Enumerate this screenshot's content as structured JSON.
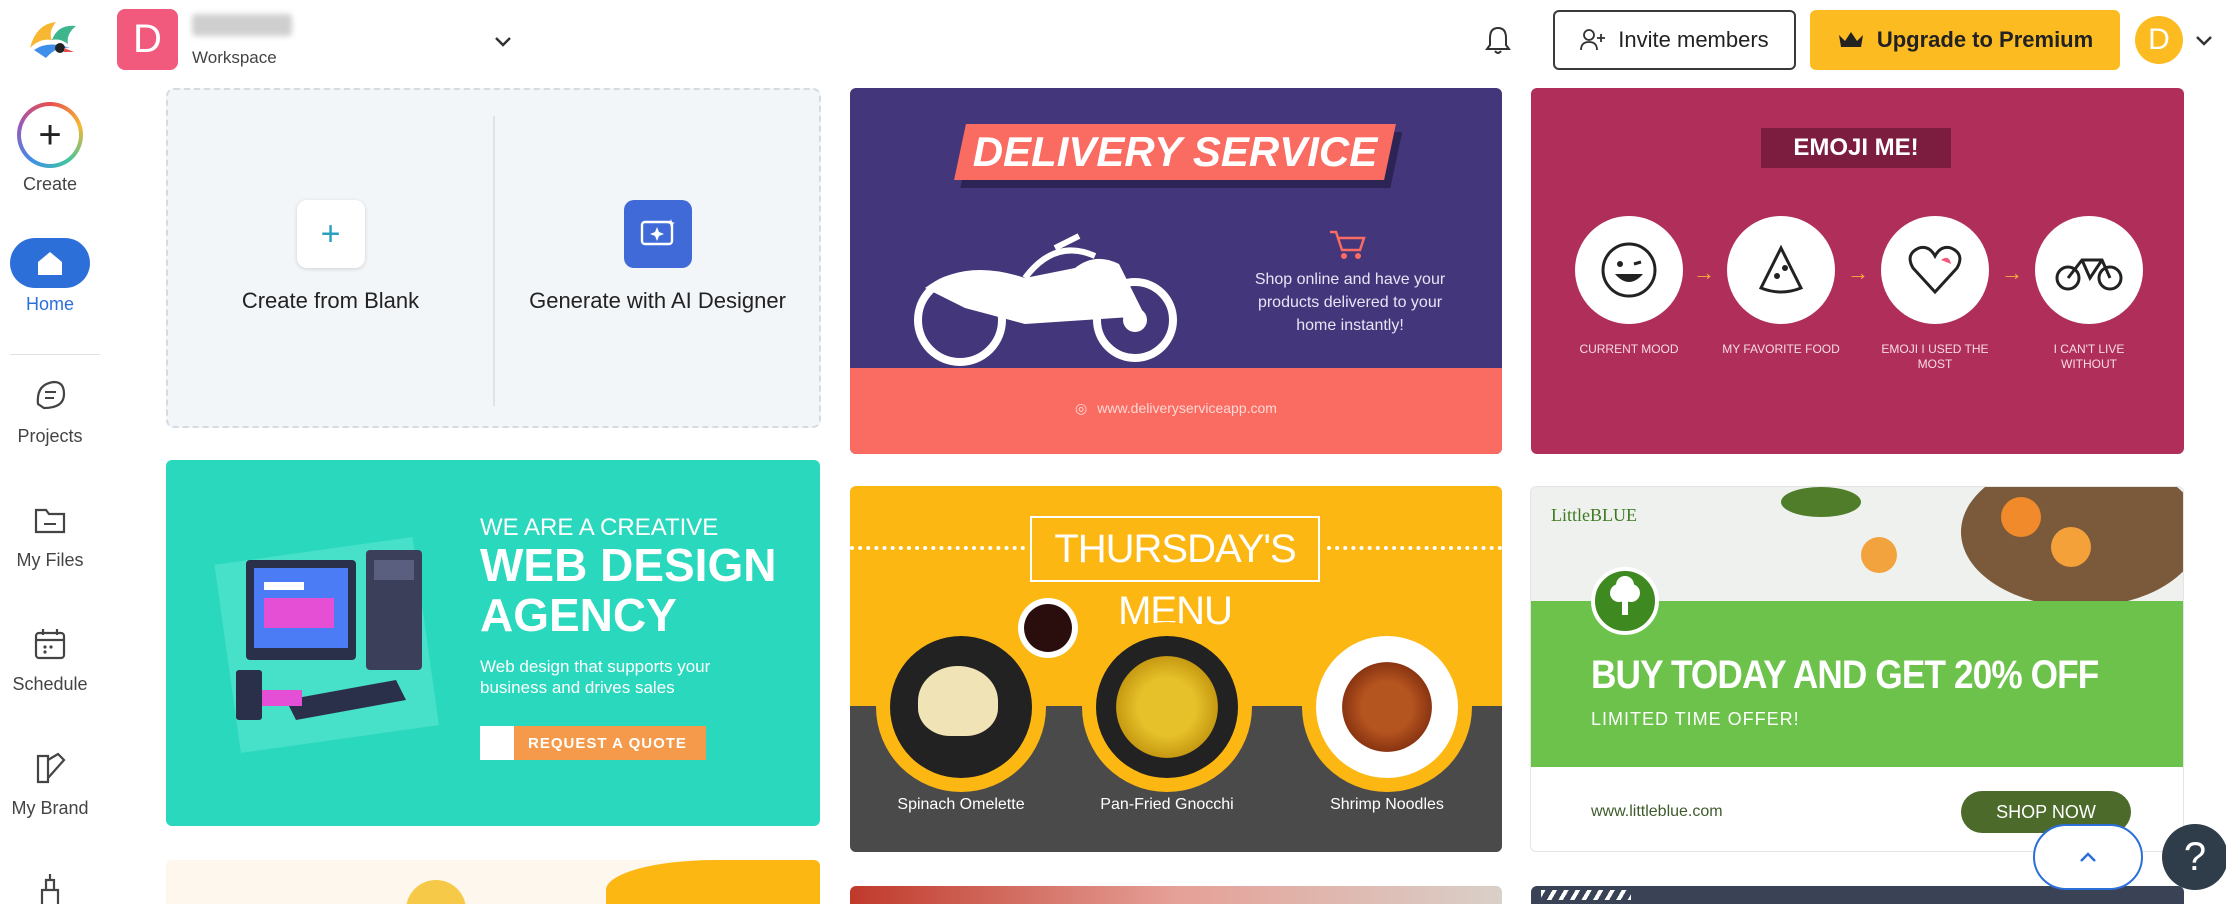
{
  "topbar": {
    "workspace_initial": "D",
    "workspace_subtitle": "Workspace",
    "invite_label": "Invite members",
    "upgrade_label": "Upgrade to Premium",
    "user_initial": "D"
  },
  "sidebar": {
    "items": [
      {
        "label": "Create",
        "icon": "plus-icon"
      },
      {
        "label": "Home",
        "icon": "home-icon"
      },
      {
        "label": "Projects",
        "icon": "projects-icon"
      },
      {
        "label": "My Files",
        "icon": "folder-icon"
      },
      {
        "label": "Schedule",
        "icon": "calendar-icon"
      },
      {
        "label": "My Brand",
        "icon": "brand-icon"
      }
    ]
  },
  "create_card": {
    "blank_label": "Create from Blank",
    "ai_label": "Generate with AI Designer"
  },
  "templates": {
    "delivery": {
      "title": "DELIVERY SERVICE",
      "text": "Shop online and have your products delivered to your home instantly!",
      "url": "www.deliveryserviceapp.com"
    },
    "emoji": {
      "title": "EMOJI ME!",
      "labels": [
        "CURRENT MOOD",
        "MY FAVORITE FOOD",
        "EMOJI I USED THE MOST",
        "I CAN'T LIVE WITHOUT"
      ]
    },
    "webdesign": {
      "small": "WE ARE A CREATIVE",
      "big_line1": "WEB DESIGN",
      "big_line2": "AGENCY",
      "desc": "Web design that supports your business and drives sales",
      "button": "REQUEST A QUOTE"
    },
    "thursday": {
      "title": "THURSDAY'S MENU",
      "items": [
        "Spinach Omelette",
        "Pan-Fried Gnocchi",
        "Shrimp Noodles"
      ]
    },
    "littleblue": {
      "logo": "LittleBLUE",
      "headline": "BUY TODAY AND GET 20% OFF",
      "sub": "LIMITED TIME OFFER!",
      "url": "www.littleblue.com",
      "button": "SHOP NOW"
    }
  },
  "floating": {
    "help_label": "?"
  },
  "colors": {
    "primary": "#2c6fd9",
    "premium": "#fdbb22",
    "workspace_avatar": "#f15a7c"
  }
}
